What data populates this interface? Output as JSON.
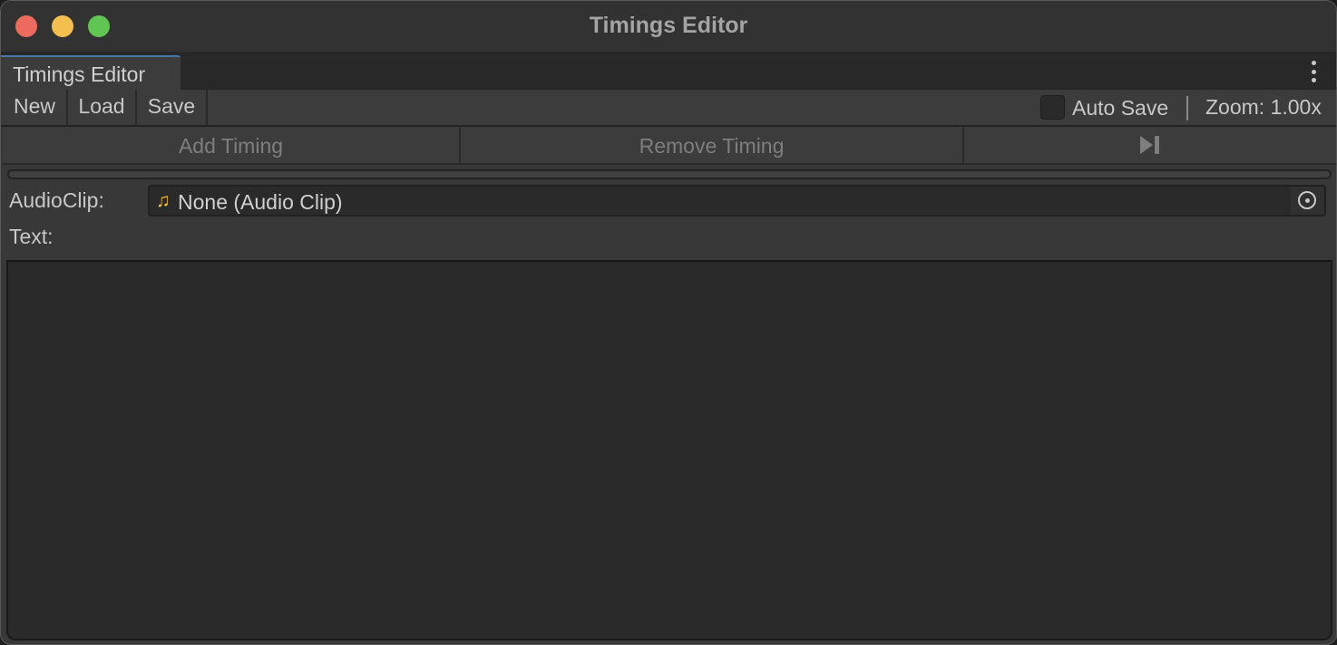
{
  "window": {
    "title": "Timings Editor",
    "traffic_lights": {
      "close": "#ec6a5e",
      "minimize": "#f4bf4f",
      "maximize": "#61c554"
    }
  },
  "tabbar": {
    "tabs": [
      {
        "label": "Timings Editor",
        "active": true
      }
    ],
    "menu_icon": "kebab-menu-icon"
  },
  "toolbar": {
    "new_label": "New",
    "load_label": "Load",
    "save_label": "Save",
    "auto_save_label": "Auto Save",
    "auto_save_checked": false,
    "zoom_label": "Zoom: 1.00x"
  },
  "actions": {
    "add_label": "Add Timing",
    "remove_label": "Remove Timing",
    "next_icon": "skip-next-icon"
  },
  "fields": {
    "audioclip_label": "AudioClip:",
    "audioclip_value": "None (Audio Clip)",
    "audioclip_icon": "music-note-icon",
    "text_label": "Text:",
    "text_value": ""
  },
  "colors": {
    "accent_tab": "#4a77a8",
    "audio_icon": "#f5be35"
  }
}
